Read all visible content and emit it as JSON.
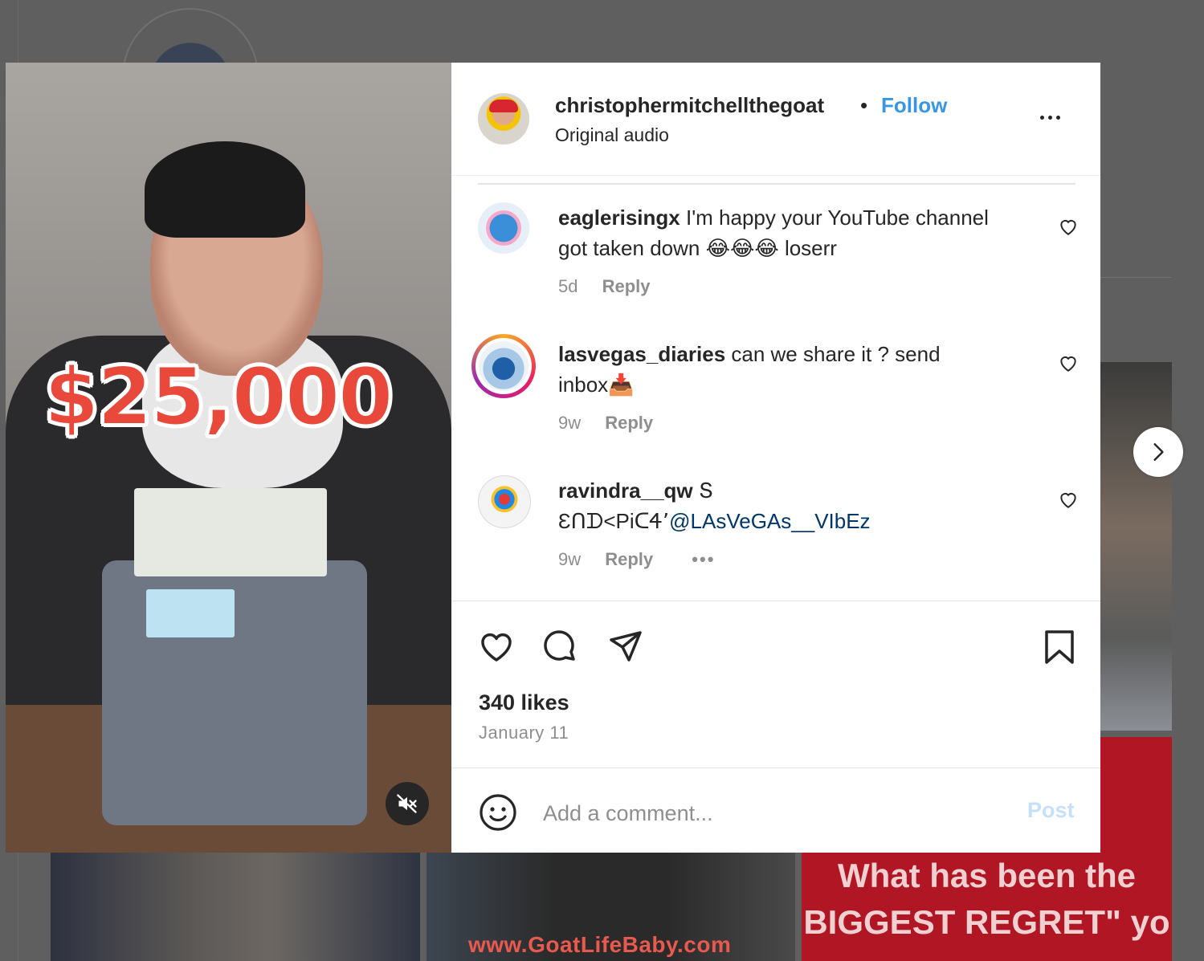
{
  "media": {
    "overlay_text": "$25,000"
  },
  "background": {
    "tile_url_text": "www.GoatLifeBaby.com",
    "tile_caption_line1": "What has been the",
    "tile_caption_line2": "BIGGEST REGRET\" yo"
  },
  "post": {
    "username": "christophermitchellthegoat",
    "separator": "•",
    "follow_label": "Follow",
    "audio_label": "Original audio",
    "likes": "340 likes",
    "date": "January 11"
  },
  "comments": [
    {
      "username": "eaglerisingx",
      "text_line1": "I'm happy your YouTube channel",
      "text_line2": "got taken down 😂😂😂 loserr",
      "age": "5d",
      "reply_label": "Reply"
    },
    {
      "username": "lasvegas_diaries",
      "text_line1": "can we share it ? send",
      "text_line2": "inbox📥",
      "age": "9w",
      "reply_label": "Reply"
    },
    {
      "username": "ravindra__qw",
      "text_line1": "Տ",
      "text_line2_prefix": "ƐՈᗪ<ΡiᑕᏎ՚",
      "mention": "@LAsVeGAs__VIbEz",
      "age": "9w",
      "reply_label": "Reply",
      "more_label": "•••"
    }
  ],
  "composer": {
    "placeholder": "Add a comment...",
    "post_label": "Post"
  },
  "colors": {
    "follow": "#3797e4",
    "post_disabled": "#c5e0fa",
    "mention": "#00376b"
  },
  "icons": [
    "mute-icon",
    "more-icon",
    "heart-icon",
    "comment-icon",
    "share-icon",
    "bookmark-icon",
    "emoji-icon",
    "chevron-right-icon"
  ]
}
